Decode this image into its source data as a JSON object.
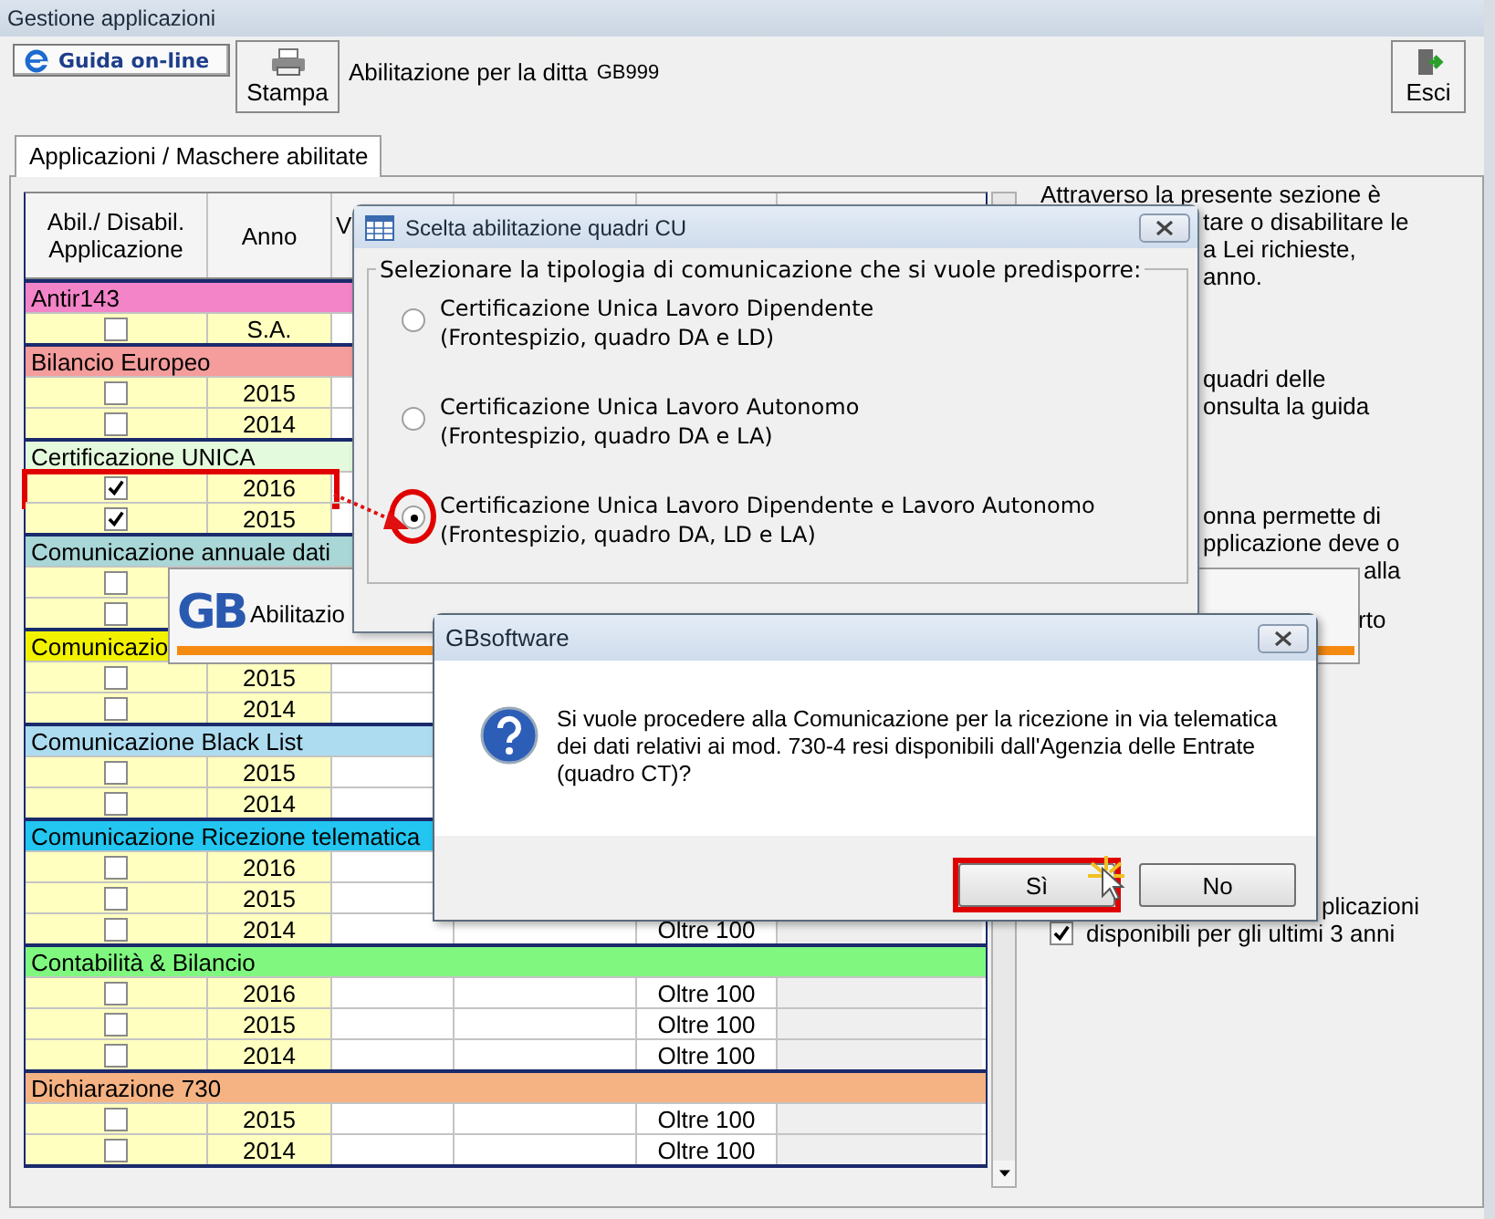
{
  "window": {
    "title": "Gestione applicazioni"
  },
  "toolbar": {
    "help_button": "Guida on-line",
    "print_button": "Stampa",
    "company_label": "Abilitazione per la ditta",
    "company_code": "GB999",
    "exit_button": "Esci"
  },
  "tabs": [
    {
      "label": "Applicazioni / Maschere abilitate",
      "selected": true
    }
  ],
  "table": {
    "columns": [
      "Abil./ Disabil. Applicazione",
      "Anno",
      "V"
    ],
    "groups": [
      {
        "name": "Antir143",
        "color": "#f384c8",
        "rows": [
          {
            "checked": false,
            "highlighted": false,
            "year": "S.A."
          }
        ]
      },
      {
        "name": "Bilancio Europeo",
        "color": "#f59c9c",
        "rows": [
          {
            "checked": false,
            "highlighted": false,
            "year": "2015"
          },
          {
            "checked": false,
            "highlighted": false,
            "year": "2014"
          }
        ]
      },
      {
        "name": "Certificazione UNICA",
        "color": "#e4fadc",
        "rows": [
          {
            "checked": true,
            "highlighted": true,
            "year": "2016"
          },
          {
            "checked": true,
            "highlighted": false,
            "year": "2015"
          }
        ]
      },
      {
        "name": "Comunicazione annuale dati",
        "color": "#a9d6d6",
        "rows": [
          {
            "checked": false,
            "highlighted": false
          },
          {
            "checked": false,
            "highlighted": false
          }
        ]
      },
      {
        "name": "Comunicazio",
        "color": "#f2f200",
        "rows": [
          {
            "checked": false,
            "highlighted": false,
            "year": "2015"
          },
          {
            "checked": false,
            "highlighted": false,
            "year": "2014"
          }
        ]
      },
      {
        "name": "Comunicazione Black List",
        "color": "#addcf0",
        "rows": [
          {
            "checked": false,
            "highlighted": false,
            "year": "2015"
          },
          {
            "checked": false,
            "highlighted": false,
            "year": "2014"
          }
        ]
      },
      {
        "name": "Comunicazione Ricezione telematica",
        "color": "#22c6f0",
        "rows": [
          {
            "checked": false,
            "highlighted": false,
            "year": "2016"
          },
          {
            "checked": false,
            "highlighted": false,
            "year": "2015"
          },
          {
            "checked": false,
            "highlighted": false,
            "year": "2014",
            "column_5": "Oltre 100"
          }
        ]
      },
      {
        "name": "Contabilità & Bilancio",
        "color": "#80f880",
        "rows": [
          {
            "checked": false,
            "highlighted": false,
            "year": "2016",
            "column_5": "Oltre 100"
          },
          {
            "checked": false,
            "highlighted": false,
            "year": "2015",
            "column_5": "Oltre 100"
          },
          {
            "checked": false,
            "highlighted": false,
            "year": "2014",
            "column_5": "Oltre 100"
          }
        ]
      },
      {
        "name": "Dichiarazione 730",
        "color": "#f5b283",
        "rows": [
          {
            "checked": false,
            "highlighted": false,
            "year": "2015",
            "column_5": "Oltre 100"
          },
          {
            "checked": false,
            "highlighted": false,
            "year": "2014",
            "column_5": "Oltre 100"
          }
        ]
      }
    ]
  },
  "help_text": {
    "paragraphs": [
      [
        "Attraverso la presente sezione è",
        "tare o disabilitare le",
        "a Lei richieste,",
        "anno."
      ],
      [
        "quadri delle",
        "onsulta la guida"
      ],
      [
        "onna permette di",
        "pplicazione deve o",
        "alla",
        "rto"
      ]
    ],
    "option": {
      "checked": true,
      "lines": [
        "plicazioni",
        "disponibili per gli ultimi 3 anni"
      ]
    }
  },
  "splash": {
    "logo_text": "GB",
    "title": "Abilitazio"
  },
  "cu_dialog": {
    "title": "Scelta abilitazione quadri CU",
    "group_label": "Selezionare la tipologia di comunicazione che si vuole predisporre:",
    "options": [
      {
        "lines": [
          "Certificazione Unica Lavoro Dipendente",
          "(Frontespizio, quadro DA e LD)"
        ],
        "selected": false,
        "highlighted": false
      },
      {
        "lines": [
          "Certificazione Unica Lavoro Autonomo",
          "(Frontespizio, quadro DA e LA)"
        ],
        "selected": false,
        "highlighted": false
      },
      {
        "lines": [
          "Certificazione Unica Lavoro Dipendente e Lavoro Autonomo",
          "(Frontespizio, quadro DA, LD e LA)"
        ],
        "selected": true,
        "highlighted": true
      }
    ]
  },
  "message_box": {
    "title": "GBsoftware",
    "lines": [
      "Si vuole procedere alla Comunicazione per la ricezione in via telematica",
      "dei dati relativi ai mod. 730-4 resi disponibili dall'Agenzia delle Entrate",
      "(quadro CT)?"
    ],
    "buttons": [
      {
        "label": "Sì",
        "highlighted": true
      },
      {
        "label": "No",
        "highlighted": false
      }
    ]
  }
}
